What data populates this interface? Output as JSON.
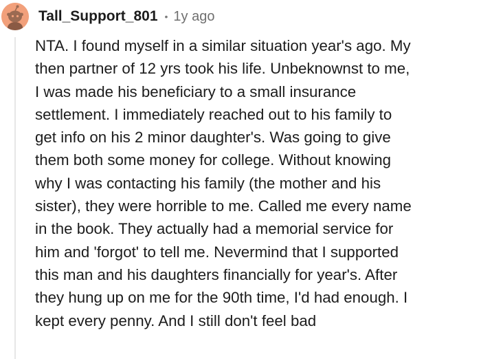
{
  "comment": {
    "author": "Tall_Support_801",
    "separator": "•",
    "age": "1y ago",
    "avatar_icon": "snoo-avatar-icon",
    "avatar_color": "#f2a07b",
    "lines": [
      "NTA. I found myself in a similar situation year's ago. My",
      "then partner of 12 yrs took his life. Unbeknownst to me,",
      "I was made his beneficiary to a small insurance",
      "settlement. I immediately reached out to his family to",
      "get info on his 2 minor daughter's. Was going to give",
      "them both some money for college. Without knowing",
      "why I was contacting his family (the mother and his",
      "sister), they were horrible to me. Called me every name",
      "in the book. They actually had a memorial service for",
      "him and 'forgot' to tell me. Nevermind that I supported",
      "this man and his daughters financially for year's. After",
      "they hung up on me for the 90th time, I'd had enough. I",
      "kept every penny. And I still don't feel bad"
    ]
  }
}
